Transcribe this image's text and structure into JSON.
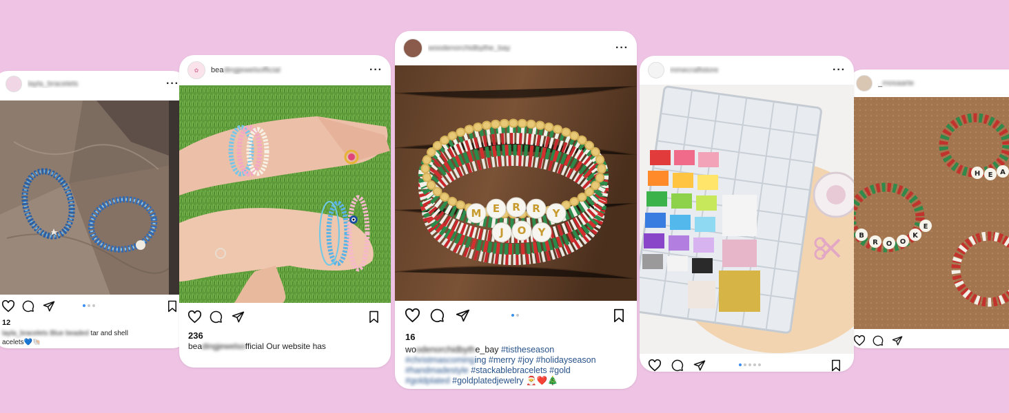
{
  "colors": {
    "background": "#eec3e4",
    "hashtag": "#27528a",
    "carousel_active": "#3a8ff0"
  },
  "posts": [
    {
      "username_visible": "",
      "username_blurred": "layla_bracelets",
      "likes": "12",
      "caption_blurred": "layla_bracelets Blue beaded ",
      "caption_text": "Blue beaded starfish and shell bracelets 💙🐚",
      "caption_visible": "tar and shell",
      "caption_line2": "acelets💙🐚"
    },
    {
      "username_visible": "bea",
      "username_blurred": "dingjewelsofficial",
      "likes": "236",
      "caption_user_visible": "bea",
      "caption_user_blurred": "dingjewelso",
      "caption_user_tail": "fficial",
      "caption_text": " Our website has"
    },
    {
      "username_blurred": "woodenorchidbythe_bay",
      "likes": "16",
      "bracelet_letters_top": [
        "M",
        "E",
        "R",
        "R",
        "Y"
      ],
      "bracelet_letters_bottom": [
        "J",
        "O",
        "Y"
      ],
      "caption_user_visible": "wo",
      "caption_user_blurred": "odenorchidbyth",
      "caption_user_tail": "e_bay",
      "hashtags_line1": "#tistheseason",
      "line2_blurred": "#christmascoming",
      "line2_visible": "ing #merry #joy #holidayseason",
      "line3_blurred": "#handmadestyle",
      "line3_visible": " #stackablebracelets #gold",
      "line4_blurred": "#goldplated",
      "line4_visible": " #goldplatedjewelry 🎅❤️🎄"
    },
    {
      "username_blurred": "mmecraftstore"
    },
    {
      "username_visible": "_",
      "username_blurred": "mosaarte",
      "bracelet_word": "BROOKE",
      "bracelet_word2": "HEA"
    }
  ]
}
